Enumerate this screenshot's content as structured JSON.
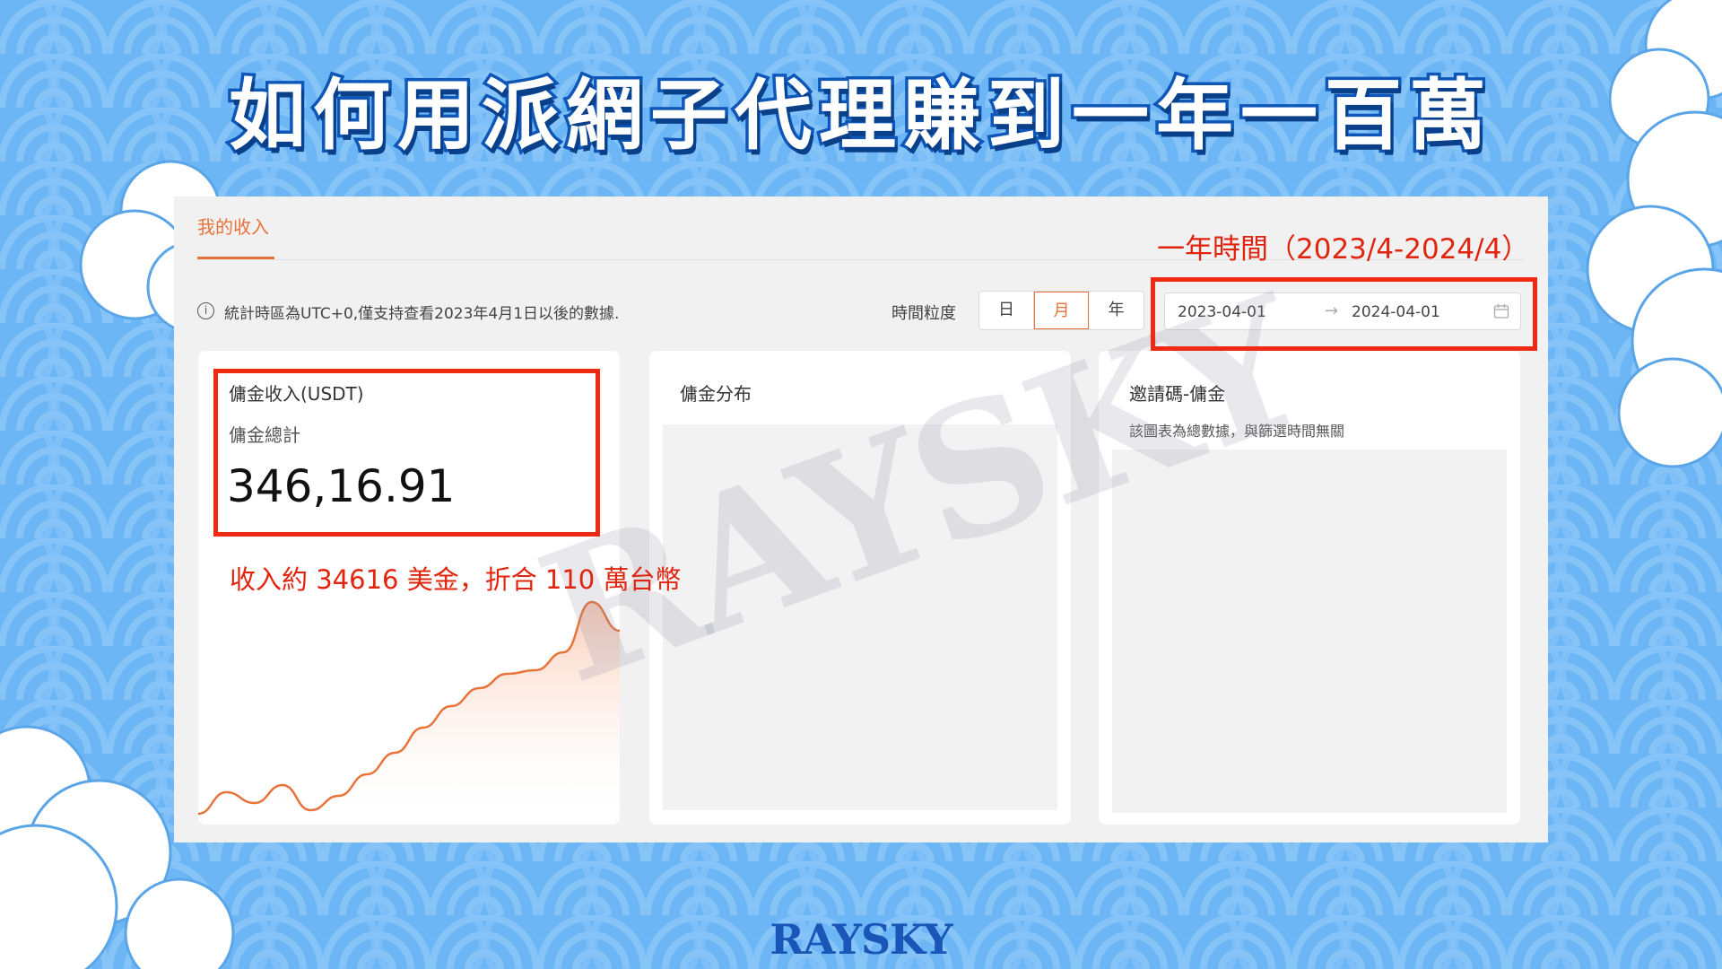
{
  "slide": {
    "title": "如何用派網子代理賺到一年一百萬",
    "watermark": "RAYSKY",
    "brand": "RAYSKY"
  },
  "page": {
    "tab_label": "我的收入",
    "info_text": "統計時區為UTC+0,僅支持查看2023年4月1日以後的數據.",
    "granularity_label": "時間粒度",
    "granularity_options": [
      "日",
      "月",
      "年"
    ],
    "granularity_selected": "月",
    "date_range": {
      "start": "2023-04-01",
      "end": "2024-04-01",
      "arrow": "→"
    }
  },
  "cards": {
    "commission_income": {
      "title": "傭金收入(USDT)",
      "subtitle": "傭金總計",
      "total": "346,16.91"
    },
    "commission_distribution": {
      "title": "傭金分布"
    },
    "invite_code": {
      "title": "邀請碼-傭金",
      "subtitle": "該圖表為總數據，與篩選時間無關"
    }
  },
  "annotations": {
    "date_note": "一年時間（2023/4-2024/4）",
    "income_note": "收入約 34616 美金，折合 110 萬台幣"
  },
  "colors": {
    "accent": "#e8733a",
    "highlight": "#ee2a12",
    "background": "#6db6f5",
    "title_stroke": "#0e57b8"
  },
  "chart_data": {
    "type": "area",
    "title": "",
    "xlabel": "",
    "ylabel": "",
    "x": [
      1,
      2,
      3,
      4,
      5,
      6,
      7,
      8,
      9,
      10,
      11,
      12,
      13,
      14,
      15,
      16
    ],
    "values": [
      3,
      9,
      6,
      11,
      4,
      8,
      14,
      20,
      27,
      33,
      38,
      42,
      43,
      48,
      62,
      54
    ],
    "ylim": [
      0,
      70
    ],
    "grid": false
  }
}
